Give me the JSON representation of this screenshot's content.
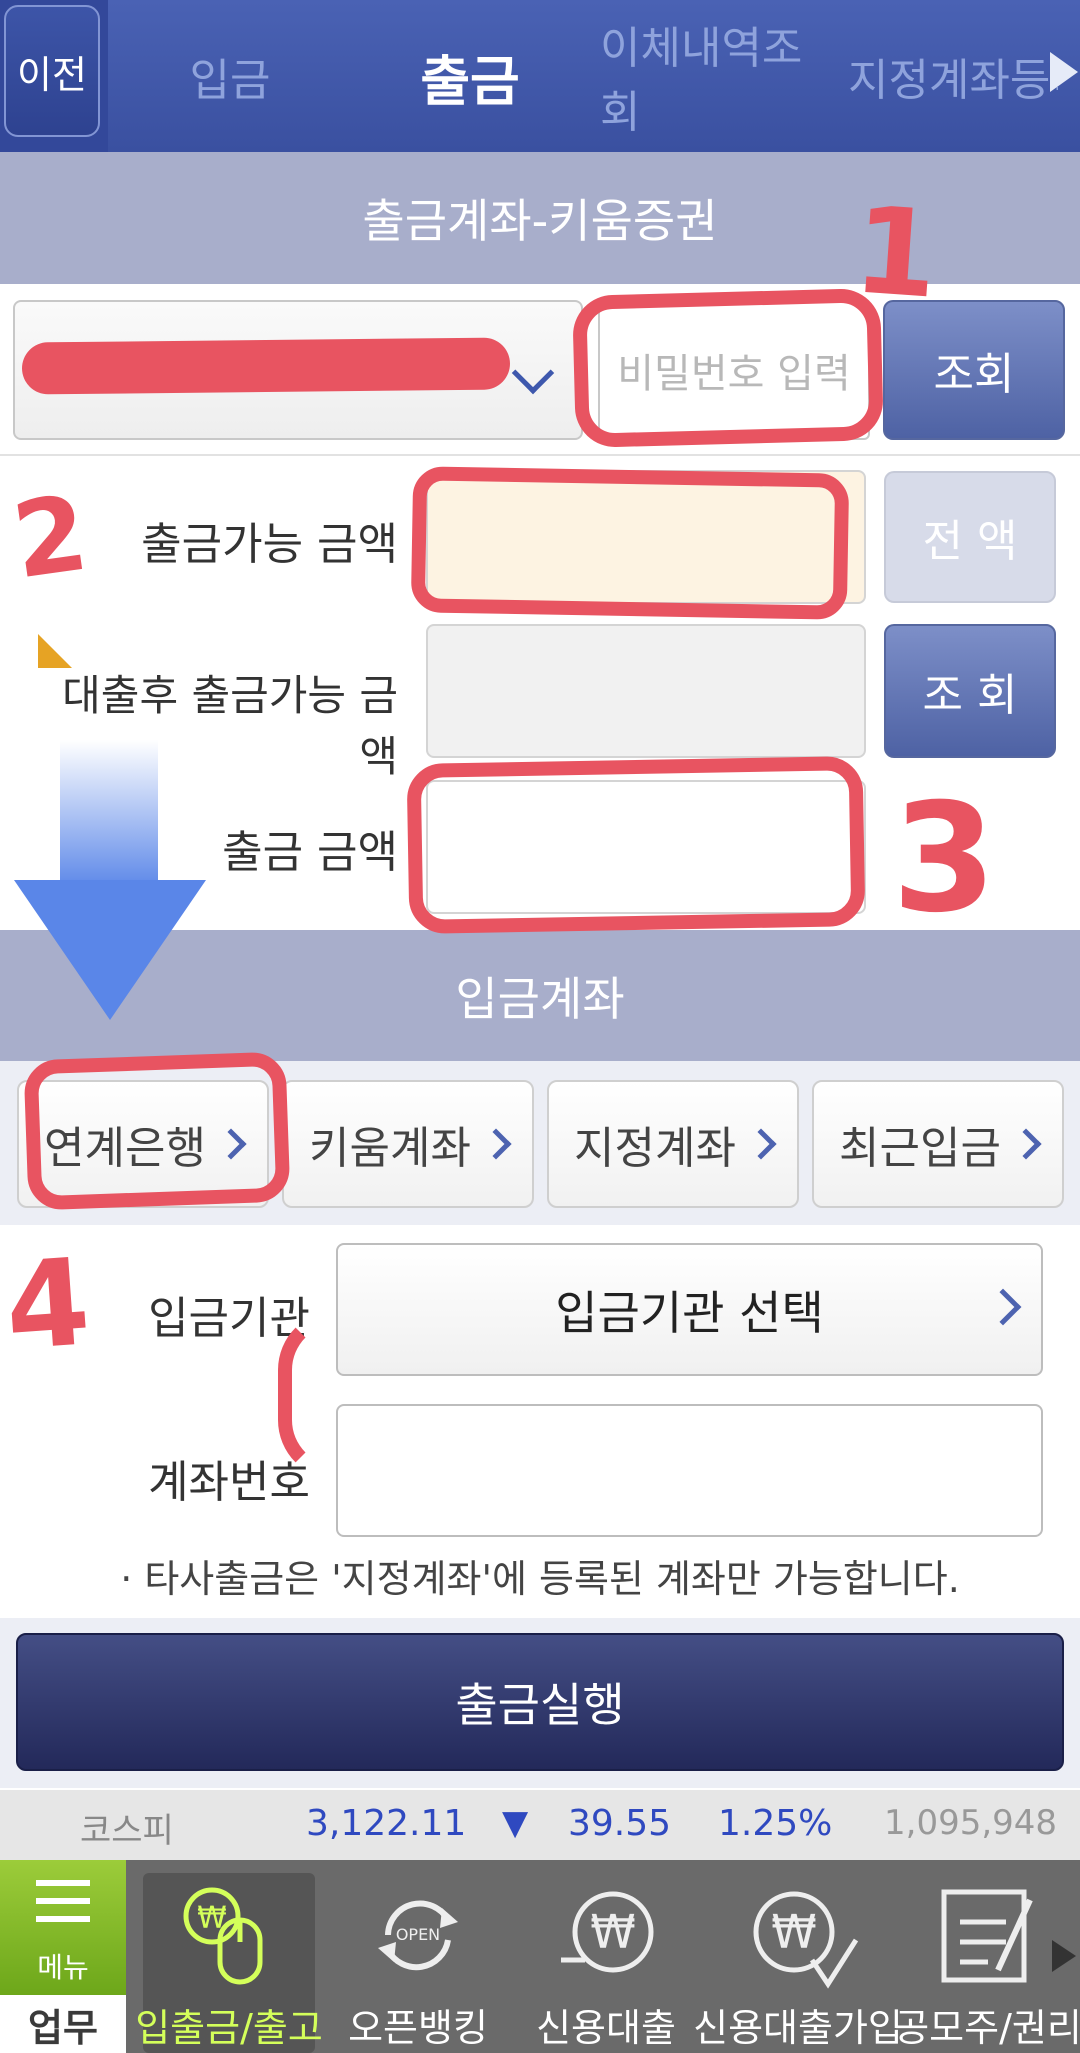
{
  "top_tabs": {
    "back": "이전",
    "tabs": [
      "입금",
      "출금",
      "이체내역조회",
      "지정계좌등록"
    ]
  },
  "withdraw": {
    "header": "출금계좌-키움증권",
    "password_placeholder": "비밀번호 입력",
    "lookup": "조회",
    "available_label": "출금가능 금액",
    "full_amount": "전 액",
    "loan_available_label": "대출후 출금가능 금액",
    "lookup2": "조 회",
    "amount_label": "출금 금액"
  },
  "deposit": {
    "header": "입금계좌",
    "bank_tabs": [
      "연계은행",
      "키움계좌",
      "지정계좌",
      "최근입금"
    ],
    "institution_label": "입금기관",
    "institution_select": "입금기관 선택",
    "account_label": "계좌번호",
    "notice": "· 타사출금은 '지정계좌'에 등록된 계좌만 가능합니다."
  },
  "execute_label": "출금실행",
  "ticker": {
    "name": "코스피",
    "value": "3,122.11",
    "arrow": "▼",
    "change": "39.55",
    "rate": "1.25%",
    "volume": "1,095,948"
  },
  "bottom_nav": {
    "menu": "메뉴",
    "work": "업무",
    "items": [
      "입출금/출고",
      "오픈뱅킹",
      "신용대출",
      "신용대출가입",
      "공모주/권리"
    ]
  },
  "annotations": [
    "1",
    "2",
    "3",
    "4"
  ],
  "colors": {
    "accent": "#4a62b4",
    "annotation": "#e85461",
    "active_green": "#d4ff5a"
  }
}
